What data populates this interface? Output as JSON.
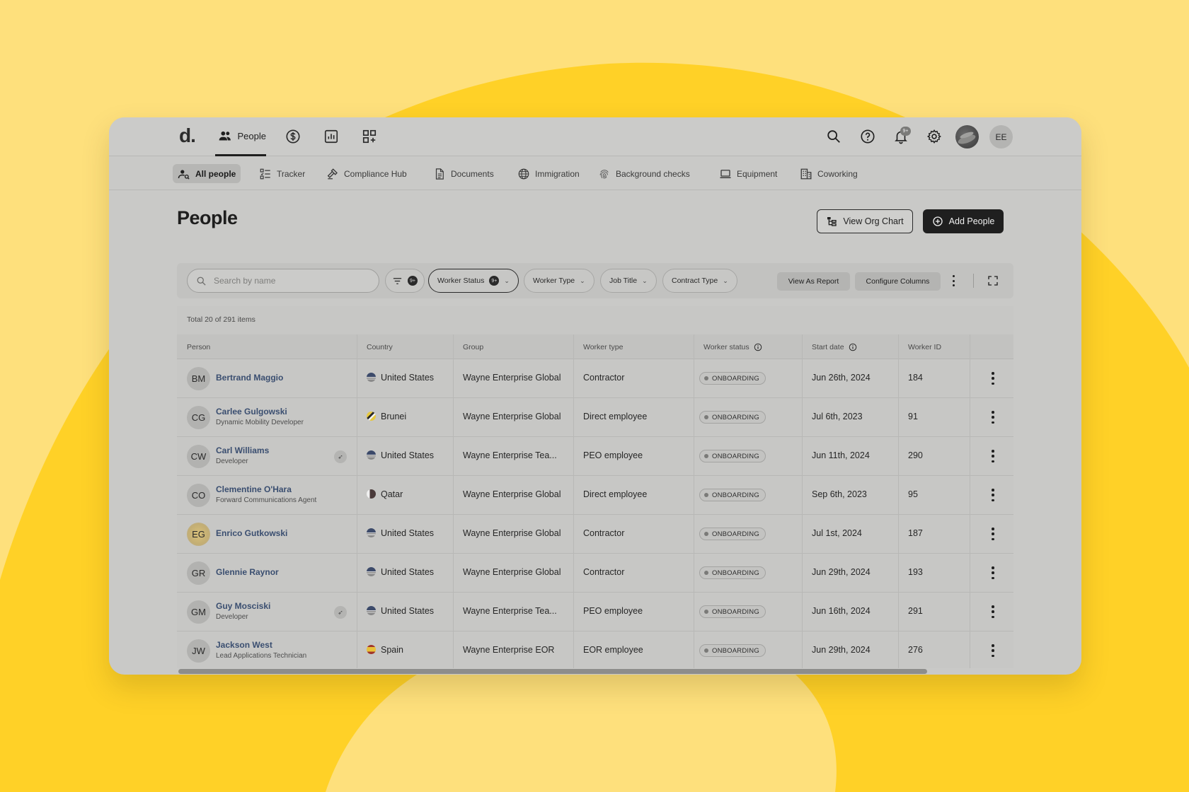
{
  "brand": {
    "logo": "d."
  },
  "topnav": {
    "people_label": "People",
    "icons": [
      "people-icon",
      "dollar-icon",
      "chart-icon",
      "apps-icon"
    ],
    "right_icons": [
      "search-icon",
      "help-icon",
      "bell-icon",
      "gear-icon"
    ],
    "notification_count": "9+",
    "user_initials": "EE"
  },
  "subnav": {
    "items": [
      {
        "label": "All people",
        "icon": "user-search-icon",
        "active": true
      },
      {
        "label": "Tracker",
        "icon": "checklist-icon"
      },
      {
        "label": "Compliance Hub",
        "icon": "gavel-icon"
      },
      {
        "label": "Documents",
        "icon": "document-icon"
      },
      {
        "label": "Immigration",
        "icon": "globe-icon"
      },
      {
        "label": "Background checks",
        "icon": "fingerprint-icon"
      },
      {
        "label": "Equipment",
        "icon": "laptop-icon"
      },
      {
        "label": "Coworking",
        "icon": "building-icon"
      }
    ]
  },
  "page": {
    "title": "People",
    "org_chart_label": "View Org Chart",
    "add_label": "Add People"
  },
  "filters": {
    "search_placeholder": "Search by name",
    "filter_count": "9+",
    "worker_status": "Worker Status",
    "worker_status_count": "9+",
    "worker_type": "Worker Type",
    "job_title": "Job Title",
    "contract_type": "Contract Type",
    "view_report": "View As Report",
    "configure_columns": "Configure Columns"
  },
  "table": {
    "total": "Total 20 of 291 items",
    "columns": [
      "Person",
      "Country",
      "Group",
      "Worker type",
      "Worker status",
      "Start date",
      "Worker ID"
    ],
    "rows": [
      {
        "initials": "BM",
        "name": "Bertrand Maggio",
        "title": "",
        "rocket": false,
        "country": "United States",
        "flag": "us",
        "group": "Wayne Enterprise Global",
        "type": "Contractor",
        "status": "ONBOARDING",
        "start": "Jun 26th, 2024",
        "id": "184"
      },
      {
        "initials": "CG",
        "name": "Carlee Gulgowski",
        "title": "Dynamic Mobility Developer",
        "rocket": false,
        "country": "Brunei",
        "flag": "bn",
        "group": "Wayne Enterprise Global",
        "type": "Direct employee",
        "status": "ONBOARDING",
        "start": "Jul 6th, 2023",
        "id": "91"
      },
      {
        "initials": "CW",
        "name": "Carl Williams",
        "title": "Developer",
        "rocket": true,
        "country": "United States",
        "flag": "us",
        "group": "Wayne Enterprise Tea...",
        "type": "PEO employee",
        "status": "ONBOARDING",
        "start": "Jun 11th, 2024",
        "id": "290"
      },
      {
        "initials": "CO",
        "name": "Clementine O'Hara",
        "title": "Forward Communications Agent",
        "rocket": false,
        "country": "Qatar",
        "flag": "qa",
        "group": "Wayne Enterprise Global",
        "type": "Direct employee",
        "status": "ONBOARDING",
        "start": "Sep 6th, 2023",
        "id": "95"
      },
      {
        "initials": "EG",
        "name": "Enrico Gutkowski",
        "title": "",
        "rocket": false,
        "gold": true,
        "country": "United States",
        "flag": "us",
        "group": "Wayne Enterprise Global",
        "type": "Contractor",
        "status": "ONBOARDING",
        "start": "Jul 1st, 2024",
        "id": "187"
      },
      {
        "initials": "GR",
        "name": "Glennie Raynor",
        "title": "",
        "rocket": false,
        "country": "United States",
        "flag": "us",
        "group": "Wayne Enterprise Global",
        "type": "Contractor",
        "status": "ONBOARDING",
        "start": "Jun 29th, 2024",
        "id": "193"
      },
      {
        "initials": "GM",
        "name": "Guy Mosciski",
        "title": "Developer",
        "rocket": true,
        "country": "United States",
        "flag": "us",
        "group": "Wayne Enterprise Tea...",
        "type": "PEO employee",
        "status": "ONBOARDING",
        "start": "Jun 16th, 2024",
        "id": "291"
      },
      {
        "initials": "JW",
        "name": "Jackson West",
        "title": "Lead Applications Technician",
        "rocket": false,
        "country": "Spain",
        "flag": "es",
        "group": "Wayne Enterprise EOR",
        "type": "EOR employee",
        "status": "ONBOARDING",
        "start": "Jun 29th, 2024",
        "id": "276"
      }
    ]
  }
}
